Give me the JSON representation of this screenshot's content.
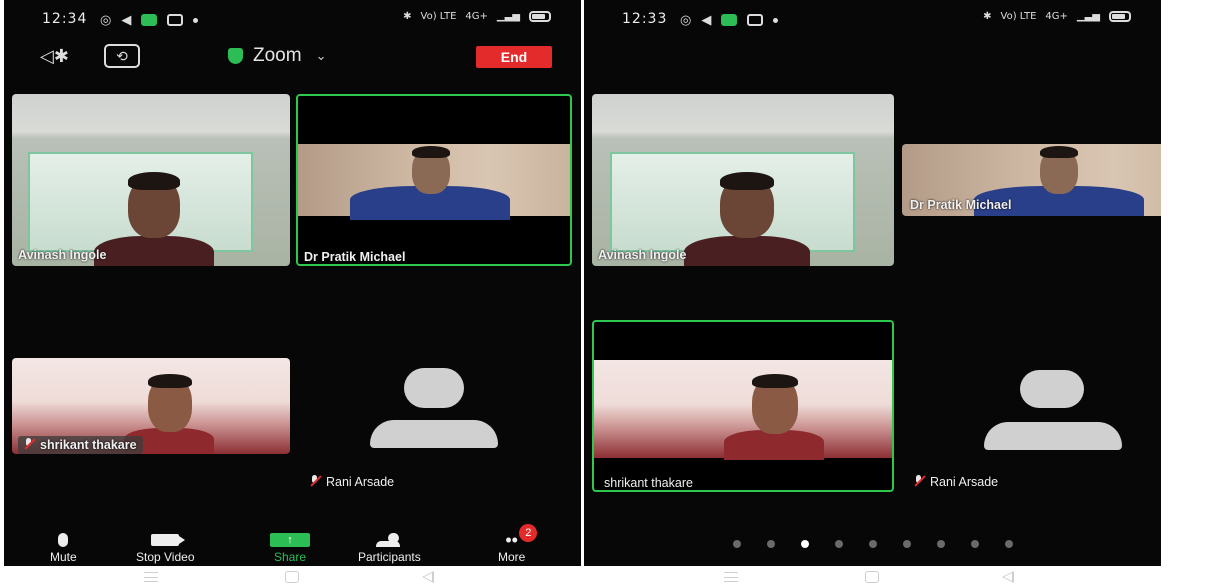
{
  "left": {
    "status": {
      "time": "12:34",
      "net_label": "Vo) LTE",
      "signal_label": "4G+"
    },
    "topbar": {
      "title": "Zoom",
      "end_label": "End"
    },
    "participants": [
      {
        "name": "Avinash Ingole"
      },
      {
        "name": "Dr Pratik Michael"
      },
      {
        "name": "shrikant thakare"
      },
      {
        "name": "Rani Arsade"
      }
    ],
    "toolbar": {
      "mute": "Mute",
      "stop_video": "Stop Video",
      "share": "Share",
      "participants": "Participants",
      "more": "More",
      "more_badge": "2",
      "accent_color": "#2dbd55",
      "end_color": "#e32b2b"
    }
  },
  "right": {
    "status": {
      "time": "12:33",
      "net_label": "Vo) LTE",
      "signal_label": "4G+"
    },
    "participants": [
      {
        "name": "Avinash Ingole"
      },
      {
        "name": "Dr Pratik Michael"
      },
      {
        "name": "shrikant thakare"
      },
      {
        "name": "Rani Arsade"
      }
    ],
    "page_dots": {
      "count": 9,
      "active_index": 2
    }
  }
}
